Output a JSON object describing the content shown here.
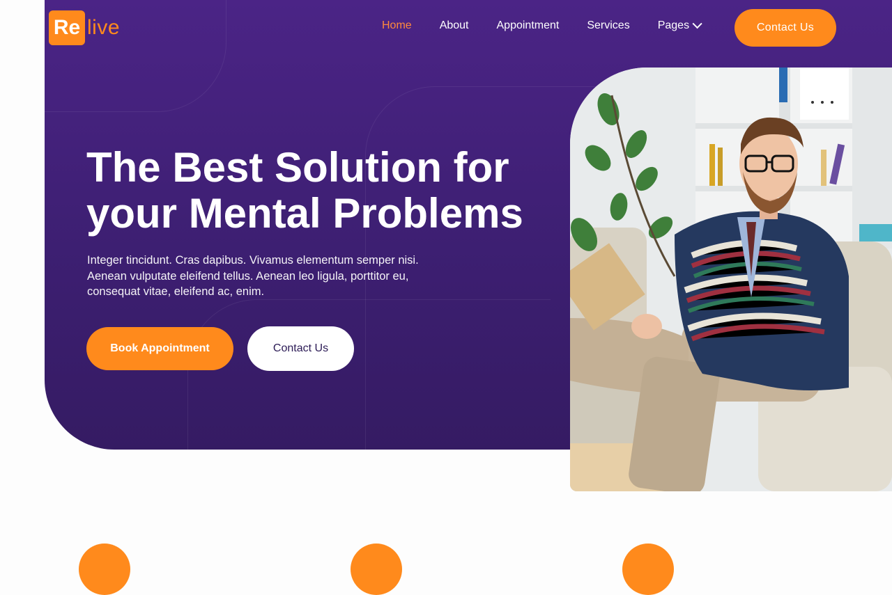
{
  "brand": {
    "logo_box": "Re",
    "logo_text": "live",
    "accent": "#ff8a1c",
    "hero_bg": "#4b2486"
  },
  "nav": {
    "items": [
      {
        "label": "Home",
        "active": true
      },
      {
        "label": "About"
      },
      {
        "label": "Appointment"
      },
      {
        "label": "Services"
      },
      {
        "label": "Pages",
        "icon": "chevron-down-icon"
      }
    ],
    "cta_label": "Contact Us"
  },
  "hero": {
    "title_line1": "The Best Solution for",
    "title_line2": "your Mental Problems",
    "description": "Integer tincidunt. Cras dapibus. Vivamus elementum semper nisi. Aenean vulputate eleifend tellus. Aenean leo ligula, porttitor eu, consequat vitae, eleifend ac, enim.",
    "primary_button": "Book Appointment",
    "secondary_button": "Contact Us"
  }
}
